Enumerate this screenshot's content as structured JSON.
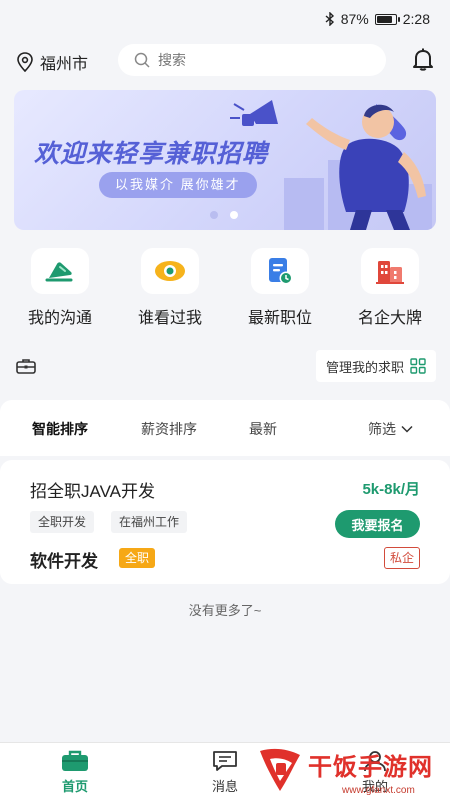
{
  "status_bar": {
    "battery": "87%",
    "battery_level": 0.87,
    "time": "2:28"
  },
  "header": {
    "city": "福州市",
    "search_placeholder": "搜索"
  },
  "banner": {
    "title": "欢迎来轻享兼职招聘",
    "subtitle": "以我媒介  展你雄才",
    "active_dot": 1
  },
  "quick_links": [
    {
      "label": "我的沟通",
      "icon": "chat-icon"
    },
    {
      "label": "谁看过我",
      "icon": "eye-icon"
    },
    {
      "label": "最新职位",
      "icon": "document-clock-icon"
    },
    {
      "label": "名企大牌",
      "icon": "building-icon"
    }
  ],
  "manage": {
    "label": "管理我的求职"
  },
  "sort_tabs": [
    {
      "label": "智能排序",
      "active": true
    },
    {
      "label": "薪资排序",
      "active": false
    },
    {
      "label": "最新",
      "active": false
    },
    {
      "label": "筛选",
      "active": false
    }
  ],
  "job": {
    "title": "招全职JAVA开发",
    "salary": "5k-8k/月",
    "tags": [
      "全职开发",
      "在福州工作"
    ],
    "apply_label": "我要报名",
    "company": "软件开发",
    "type_badge": "全职",
    "company_type": "私企"
  },
  "list_end": "没有更多了~",
  "bottom_nav": [
    {
      "label": "首页",
      "icon": "home-briefcase-icon",
      "active": true
    },
    {
      "label": "消息",
      "icon": "message-icon",
      "active": false
    },
    {
      "label": "我的",
      "icon": "profile-icon",
      "active": false
    }
  ],
  "watermark": {
    "text": "干饭手游网",
    "url": "www.gfanxt.com"
  },
  "colors": {
    "accent": "#1e9a6f",
    "banner_text": "#5560d6",
    "badge_orange": "#f6a816",
    "badge_red": "#d24b3b"
  }
}
